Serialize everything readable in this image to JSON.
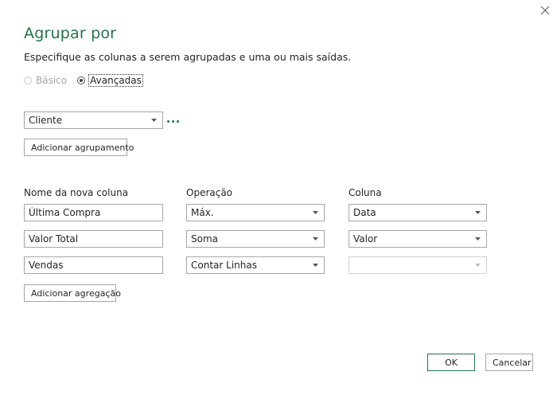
{
  "dialog": {
    "title": "Agrupar por",
    "subtitle": "Especifique as colunas a serem agrupadas e uma ou mais saídas.",
    "close_icon": "close-icon"
  },
  "mode": {
    "basic_label": "Básico",
    "advanced_label": "Avançadas",
    "selected": "advanced"
  },
  "grouping": {
    "column": "Cliente",
    "add_button": "Adicionar agrupamento"
  },
  "aggregations": {
    "headers": {
      "name": "Nome da nova coluna",
      "operation": "Operação",
      "column": "Coluna"
    },
    "rows": [
      {
        "name": "Última Compra",
        "operation": "Máx.",
        "column": "Data"
      },
      {
        "name": "Valor Total",
        "operation": "Soma",
        "column": "Valor"
      },
      {
        "name": "Vendas",
        "operation": "Contar Linhas",
        "column": ""
      }
    ],
    "add_button": "Adicionar agregação"
  },
  "footer": {
    "ok_label": "OK",
    "cancel_label": "Cancelar"
  },
  "colors": {
    "accent": "#217346",
    "text": "#252423",
    "border": "#a6a6a6",
    "disabled": "#a6a6a6"
  }
}
